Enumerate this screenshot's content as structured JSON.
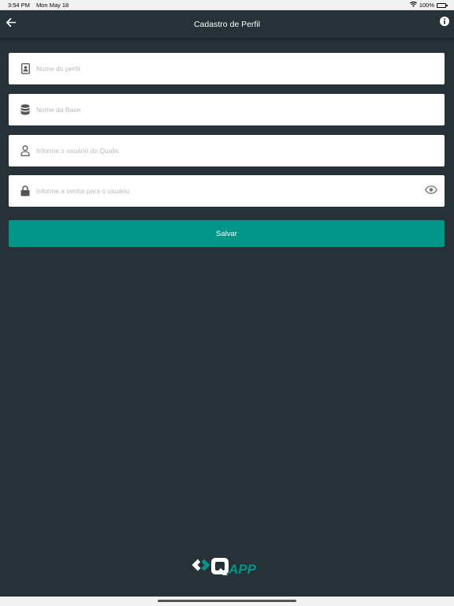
{
  "status_bar": {
    "time": "3:54 PM",
    "date": "Mon May 18",
    "battery": "100%"
  },
  "nav": {
    "title": "Cadastro de Perfil"
  },
  "form": {
    "profile_name": {
      "placeholder": "Nome do perfil",
      "value": ""
    },
    "base_name": {
      "placeholder": "Nome da Base",
      "value": ""
    },
    "user": {
      "placeholder": "Informe o usuário do Qualis",
      "value": ""
    },
    "password": {
      "placeholder": "Informe a senha para o usuário",
      "value": ""
    },
    "save_label": "Salvar"
  },
  "logo": {
    "mark": "Q",
    "suffix": "APP"
  },
  "colors": {
    "background": "#263238",
    "accent": "#009688",
    "field": "#ffffff",
    "icon": "#555555"
  },
  "icons": [
    "back-arrow-icon",
    "info-icon",
    "id-card-icon",
    "database-icon",
    "user-icon",
    "lock-icon",
    "eye-icon",
    "wifi-icon",
    "battery-icon"
  ]
}
